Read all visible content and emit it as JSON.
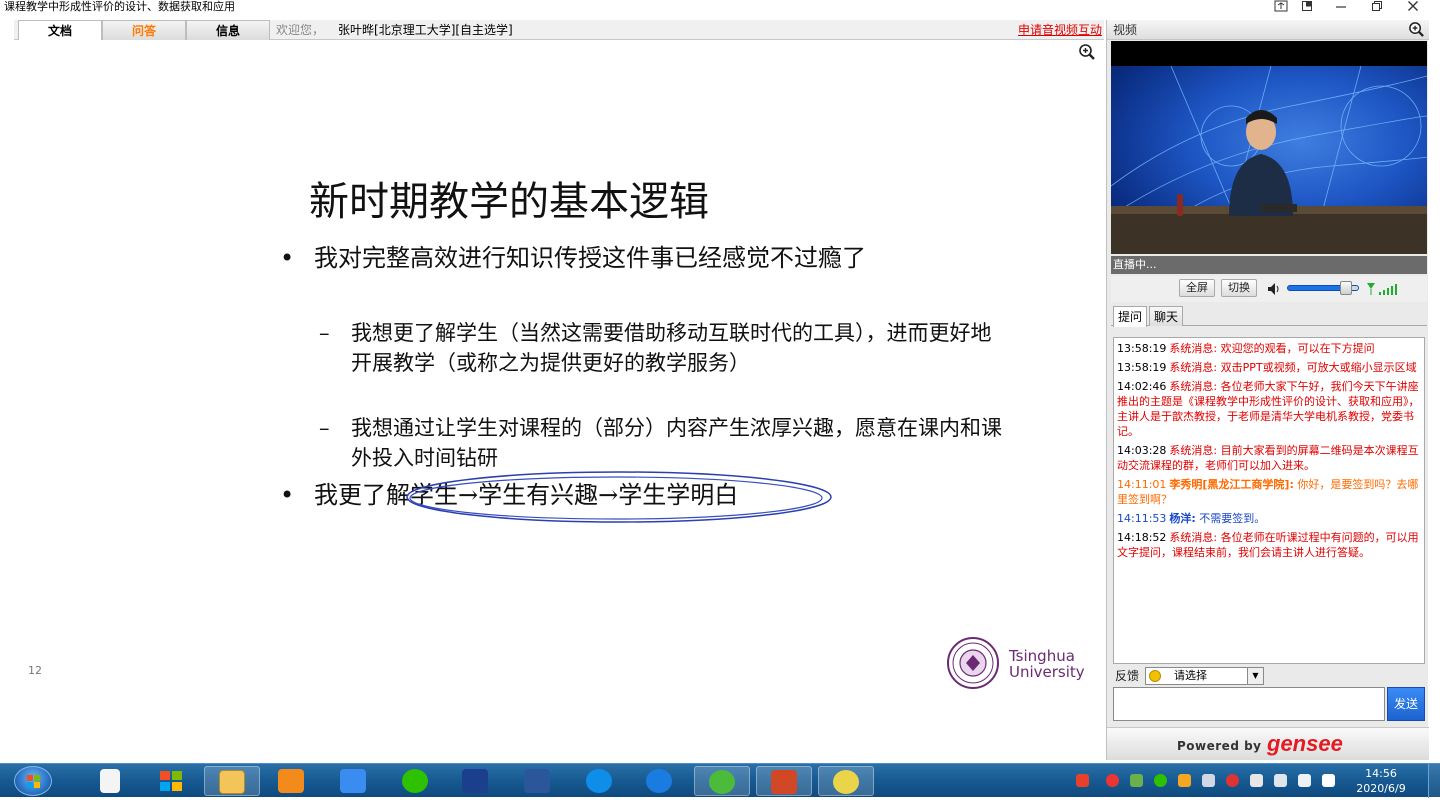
{
  "window": {
    "title": "课程教学中形成性评价的设计、数据获取和应用"
  },
  "tabs": [
    {
      "label": "文档"
    },
    {
      "label": "问答"
    },
    {
      "label": "信息"
    }
  ],
  "header": {
    "welcome": "欢迎您，",
    "user": "张叶晔[北京理工大学][自主选学]",
    "apply_link": "申请音视频互动"
  },
  "slide": {
    "title": "新时期教学的基本逻辑",
    "bullet_symbol": "•",
    "dash_symbol": "–",
    "bullet1": "我对完整高效进行知识传授这件事已经感觉不过瘾了",
    "sub1": "我想更了解学生（当然这需要借助移动互联时代的工具），进而更好地开展教学（或称之为提供更好的教学服务）",
    "sub2": "我想通过让学生对课程的（部分）内容产生浓厚兴趣，愿意在课内和课外投入时间钻研",
    "bullet2": "我更了解学生→学生有兴趣→学生学明白",
    "page_number": "12",
    "logo_line1": "Tsinghua",
    "logo_line2": "University"
  },
  "video_panel": {
    "header": "视频",
    "status": "直播中...",
    "fullscreen_btn": "全屏",
    "switch_btn": "切换",
    "volume_level": 0.82
  },
  "chat": {
    "tabs": [
      {
        "label": "提问"
      },
      {
        "label": "聊天"
      }
    ],
    "messages": [
      {
        "time": "13:58:19",
        "text": "系统消息: 欢迎您的观看，可以在下方提问",
        "kind": "system"
      },
      {
        "time": "13:58:19",
        "text": "系统消息: 双击PPT或视频，可放大或缩小显示区域",
        "kind": "system"
      },
      {
        "time": "14:02:46",
        "text": "系统消息: 各位老师大家下午好，我们今天下午讲座推出的主题是《课程教学中形成性评价的设计、获取和应用》，主讲人是于歆杰教授，于老师是清华大学电机系教授，党委书记。",
        "kind": "system"
      },
      {
        "time": "14:03:28",
        "text": "系统消息: 目前大家看到的屏幕二维码是本次课程互动交流课程的群，老师们可以加入进来。",
        "kind": "system"
      },
      {
        "time": "14:11:01",
        "who": "李秀明[黑龙江工商学院]:",
        "text": " 你好，是要签到吗？去哪里签到啊？",
        "kind": "user-orange"
      },
      {
        "time": "14:11:53",
        "who": "杨洋:",
        "text": " 不需要签到。",
        "kind": "user-blue"
      },
      {
        "time": "14:18:52",
        "text": "系统消息: 各位老师在听课过程中有问题的，可以用文字提问，课程结束前，我们会请主讲人进行答疑。",
        "kind": "system"
      }
    ],
    "feedback_label": "反馈",
    "feedback_selected": "请选择",
    "send_btn": "发送",
    "powered_by": "Powered by",
    "brand": "gensee"
  },
  "taskbar": {
    "time": "14:56",
    "date": "2020/6/9"
  },
  "colors": {
    "system_msg": "#e00000",
    "user_orange": "#ff6a00",
    "user_blue": "#1a48c9",
    "taskbar": "#175a92"
  }
}
